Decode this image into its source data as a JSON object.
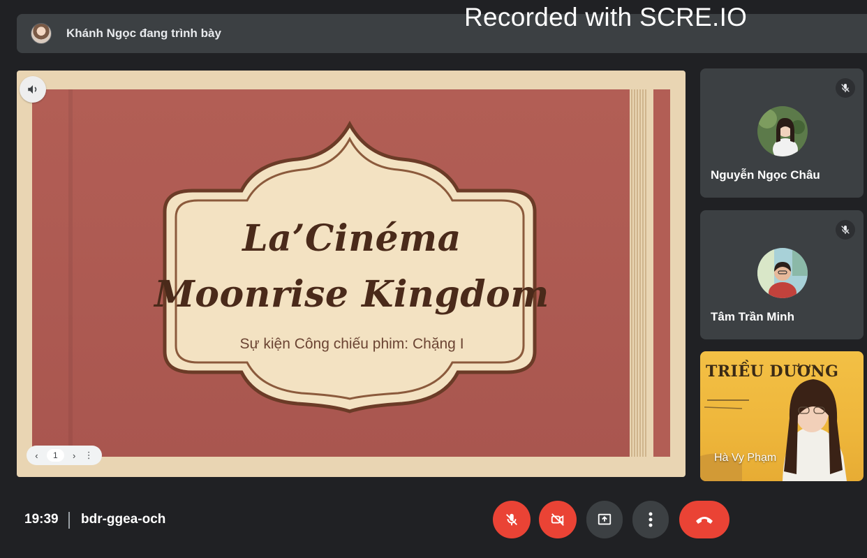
{
  "watermark": "Recorded with SCRE.IO",
  "presenter_bar": {
    "label": "Khánh Ngọc đang trình bày"
  },
  "slide": {
    "title_line1": "La’Cinéma",
    "title_line2": "Moonrise Kingdom",
    "subtitle": "Sự kiện Công chiếu phim: Chặng I",
    "page_number": "1",
    "colors": {
      "background": "#b25e55",
      "frame": "#e9d5b3",
      "label": "#f3e2c2",
      "text": "#4a2a1a"
    }
  },
  "participants": [
    {
      "name": "Nguyễn Ngọc Châu",
      "muted": true
    },
    {
      "name": "Tâm Trần Minh",
      "muted": true
    },
    {
      "name": "Hà Vy Phạm",
      "muted": true,
      "video_brand": "TRIỀU DƯƠNG"
    }
  ],
  "meeting": {
    "time": "19:39",
    "code": "bdr-ggea-och"
  },
  "controls": [
    {
      "icon": "mic-off-icon"
    },
    {
      "icon": "camera-off-icon"
    },
    {
      "icon": "present-icon"
    },
    {
      "icon": "more-vert-icon"
    },
    {
      "icon": "end-call-icon"
    }
  ],
  "colors": {
    "background": "#202124",
    "tile": "#3c4043",
    "danger": "#ea4335"
  }
}
